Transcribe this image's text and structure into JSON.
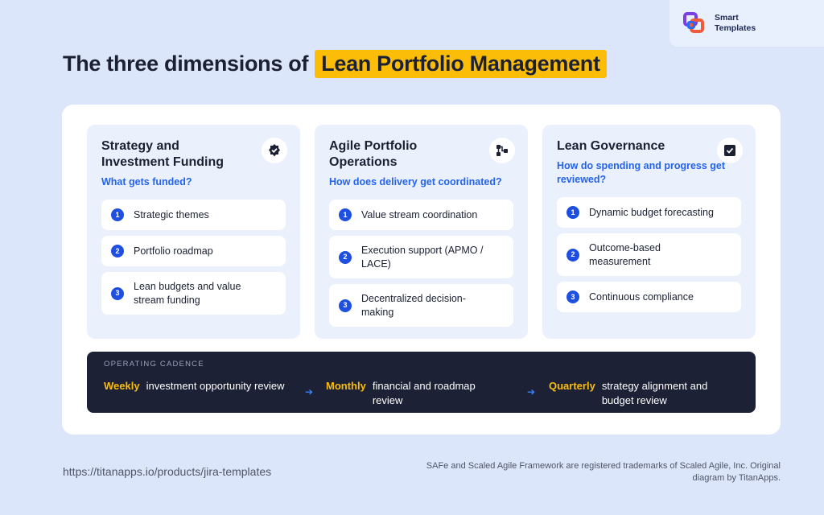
{
  "brand": {
    "line1": "Smart",
    "line2": "Templates"
  },
  "title": {
    "prefix": "The three dimensions of",
    "highlight": "Lean Portfolio Management"
  },
  "columns": [
    {
      "title": "Strategy and Investment Funding",
      "question": "What gets funded?",
      "icon": "verified-badge-icon",
      "items": [
        {
          "num": "1",
          "text": "Strategic themes"
        },
        {
          "num": "2",
          "text": "Portfolio roadmap"
        },
        {
          "num": "3",
          "text": "Lean budgets and value stream funding"
        }
      ]
    },
    {
      "title": "Agile Portfolio Operations",
      "question": "How does delivery get coordinated?",
      "icon": "flow-diagram-icon",
      "items": [
        {
          "num": "1",
          "text": "Value stream coordination"
        },
        {
          "num": "2",
          "text": "Execution support (APMO / LACE)"
        },
        {
          "num": "3",
          "text": "Decentralized decision-making"
        }
      ]
    },
    {
      "title": "Lean Governance",
      "question": "How do spending and progress get reviewed?",
      "icon": "checkbox-icon",
      "items": [
        {
          "num": "1",
          "text": "Dynamic budget forecasting"
        },
        {
          "num": "2",
          "text": "Outcome-based measurement"
        },
        {
          "num": "3",
          "text": "Continuous compliance"
        }
      ]
    }
  ],
  "cadence": {
    "label": "OPERATING CADENCE",
    "steps": [
      {
        "key": "Weekly",
        "text": "investment opportunity review"
      },
      {
        "key": "Monthly",
        "text": "financial and roadmap review"
      },
      {
        "key": "Quarterly",
        "text": "strategy alignment and budget review"
      }
    ]
  },
  "footer": {
    "url": "https://titanapps.io/products/jira-templates",
    "note": "SAFe and Scaled Agile Framework are registered trademarks of Scaled Agile, Inc. Original diagram by TitanApps."
  },
  "colors": {
    "accent_yellow": "#fbbd08",
    "accent_blue": "#2563eb",
    "dark": "#1c2136",
    "background": "#dbe6fb"
  }
}
